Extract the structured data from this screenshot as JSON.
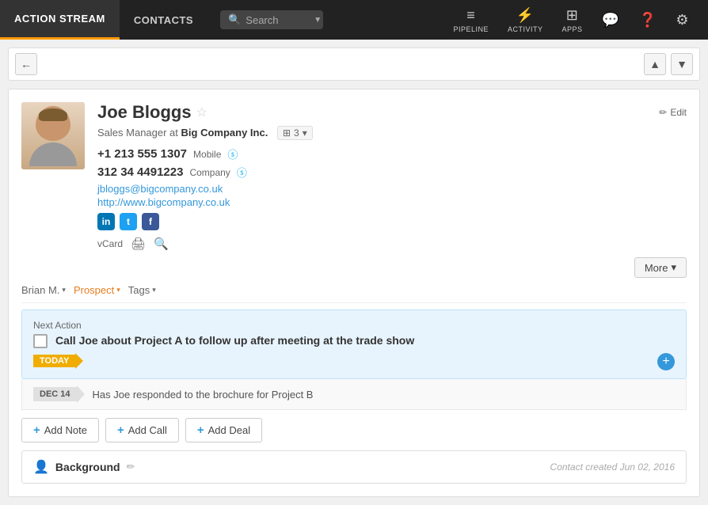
{
  "nav": {
    "action_stream_label": "ACTION STREAM",
    "contacts_label": "CONTACTS",
    "search_placeholder": "Search",
    "pipeline_label": "PIPELINE",
    "activity_label": "ACTIVITY",
    "apps_label": "APPS"
  },
  "arrows": {
    "back_label": "←",
    "up_label": "▲",
    "down_label": "▼"
  },
  "contact": {
    "name": "Joe Bloggs",
    "title": "Sales Manager at",
    "company": "Big Company Inc.",
    "company_count": "3",
    "phone1": "+1 213 555 1307",
    "phone1_label": "Mobile",
    "phone2": "312 34 4491223",
    "phone2_label": "Company",
    "email": "jbloggs@bigcompany.co.uk",
    "website": "http://www.bigcompany.co.uk",
    "vcard_label": "vCard",
    "edit_label": "Edit"
  },
  "more_btn": "More",
  "tags": {
    "owner": "Brian M.",
    "prospect_label": "Prospect",
    "tags_label": "Tags"
  },
  "next_action": {
    "section_label": "Next Action",
    "text": "Call Joe about Project A to follow up after meeting at the trade show",
    "today_badge": "TODAY"
  },
  "secondary_activity": {
    "date": "DEC 14",
    "text": "Has Joe responded to the brochure for Project B"
  },
  "action_buttons": {
    "add_note": "Add Note",
    "add_call": "Add Call",
    "add_deal": "Add Deal"
  },
  "background": {
    "title": "Background",
    "created_text": "Contact created Jun 02, 2016"
  }
}
